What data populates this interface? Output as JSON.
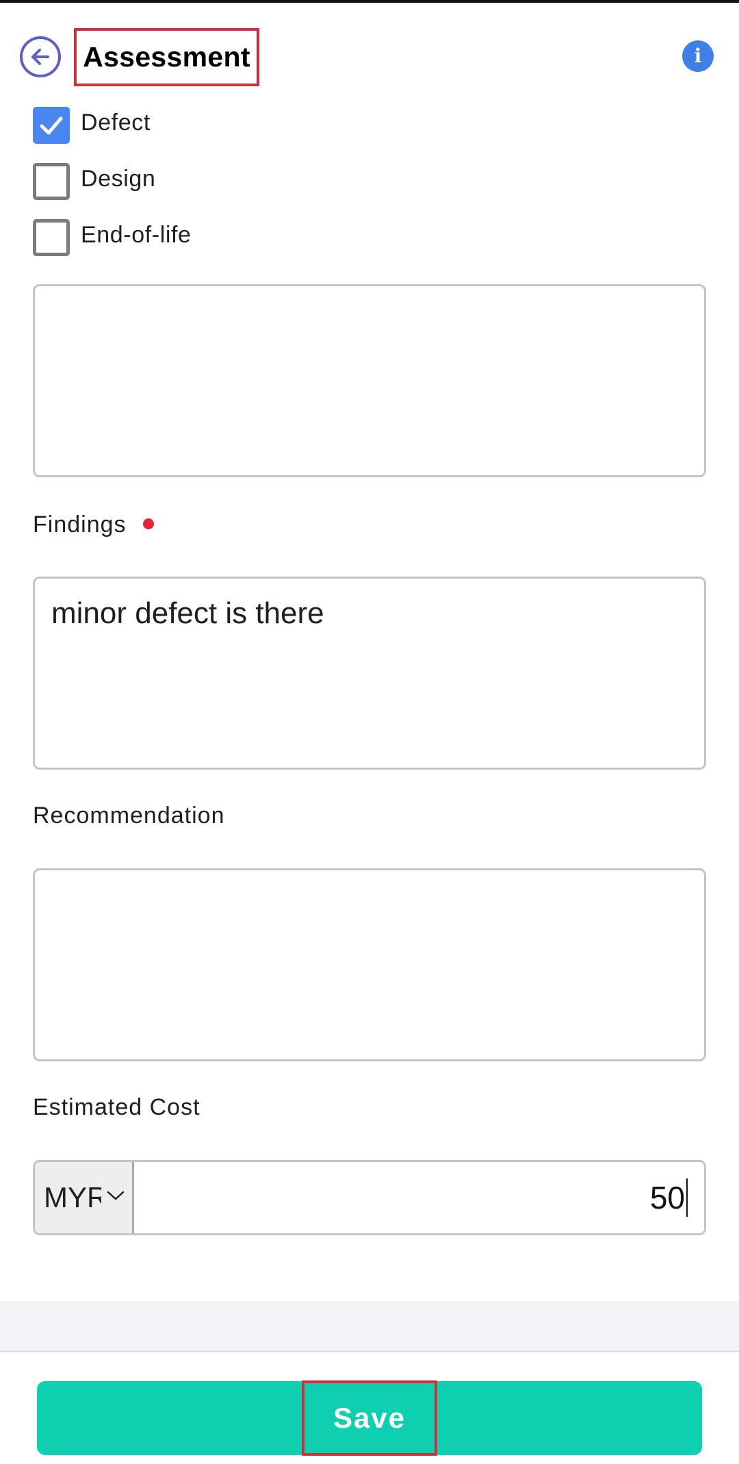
{
  "header": {
    "title": "Assessment",
    "back_icon": "arrow-left-icon",
    "info_icon": "info-icon",
    "info_glyph": "i"
  },
  "checkboxes": [
    {
      "label": "Defect",
      "checked": true
    },
    {
      "label": "Design",
      "checked": false
    },
    {
      "label": "End-of-life",
      "checked": false
    }
  ],
  "first_textarea": {
    "value": ""
  },
  "findings": {
    "label": "Findings",
    "required": true,
    "value": "minor defect is there"
  },
  "recommendation": {
    "label": "Recommendation",
    "value": ""
  },
  "estimated_cost": {
    "label": "Estimated Cost",
    "currency": "MYR",
    "value": "50"
  },
  "footer": {
    "save_label": "Save"
  },
  "colors": {
    "accent": "#0ed0b1",
    "checkbox_checked": "#4a86f0",
    "back_icon": "#5b5fc7",
    "info_icon": "#3e7fe8",
    "required_dot": "#e32636",
    "highlight_box": "#d32f3a"
  }
}
